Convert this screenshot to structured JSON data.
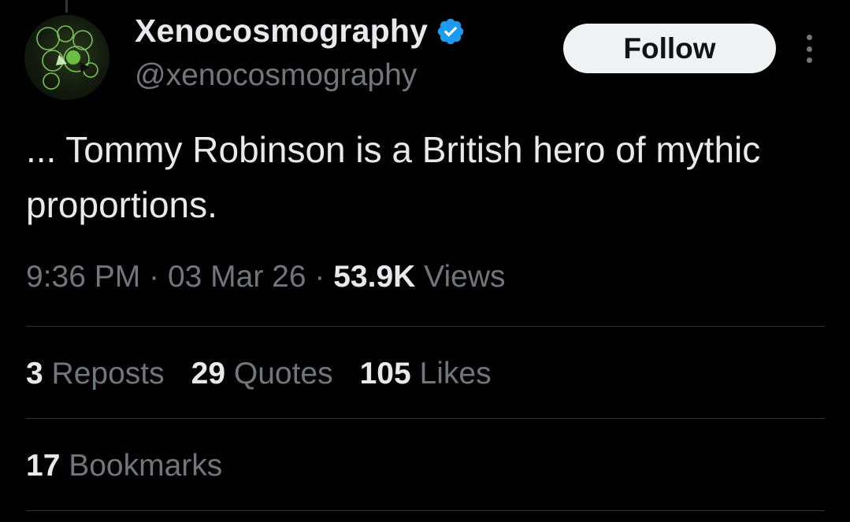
{
  "user": {
    "display_name": "Xenocosmography",
    "handle": "@xenocosmography",
    "verified_icon": "verified-badge-icon",
    "badge_color": "#1d9bf0"
  },
  "actions": {
    "follow_label": "Follow",
    "more_icon": "more-vertical-icon"
  },
  "tweet": {
    "text": "... Tommy Robinson is a British hero of mythic proportions."
  },
  "meta": {
    "time": "9:36 PM",
    "separator": "·",
    "date": "03 Mar 26",
    "views_count": "53.9K",
    "views_label": "Views"
  },
  "stats": {
    "reposts_count": "3",
    "reposts_label": "Reposts",
    "quotes_count": "29",
    "quotes_label": "Quotes",
    "likes_count": "105",
    "likes_label": "Likes",
    "bookmarks_count": "17",
    "bookmarks_label": "Bookmarks"
  },
  "colors": {
    "background": "#000000",
    "text_primary": "#e7e9ea",
    "text_secondary": "#71767b",
    "divider": "#2f3336",
    "button_bg": "#eff3f4"
  }
}
